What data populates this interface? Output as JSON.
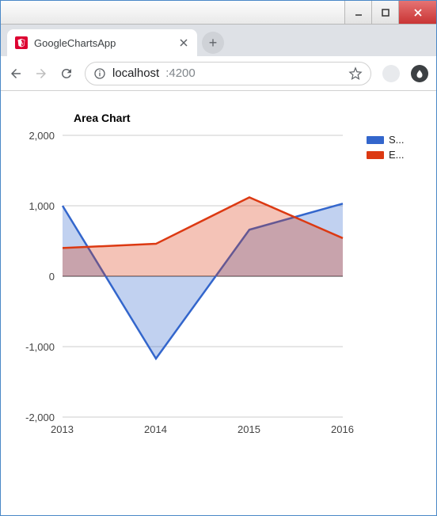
{
  "window_controls": {
    "minimize": "minimize",
    "maximize": "maximize",
    "close": "close"
  },
  "tab": {
    "title": "GoogleChartsApp"
  },
  "toolbar": {
    "url_host": "localhost",
    "url_port": ":4200"
  },
  "chart_title": "Area Chart",
  "legend": {
    "series1": "S...",
    "series2": "E..."
  },
  "yticks": {
    "p2000": "2,000",
    "p1000": "1,000",
    "zero": "0",
    "m1000": "-1,000",
    "m2000": "-2,000"
  },
  "xticks": {
    "x2013": "2013",
    "x2014": "2014",
    "x2015": "2015",
    "x2016": "2016"
  },
  "chart_data": {
    "type": "area",
    "title": "Area Chart",
    "x": [
      2013,
      2014,
      2015,
      2016
    ],
    "series": [
      {
        "name": "S",
        "color": "#3366cc",
        "values": [
          1000,
          -1170,
          660,
          1030
        ]
      },
      {
        "name": "E",
        "color": "#dc3912",
        "values": [
          400,
          460,
          1120,
          540
        ]
      }
    ],
    "xlabel": "",
    "ylabel": "",
    "ylim": [
      -2000,
      2000
    ],
    "xlim": [
      2013,
      2016
    ],
    "legend_position": "right"
  }
}
